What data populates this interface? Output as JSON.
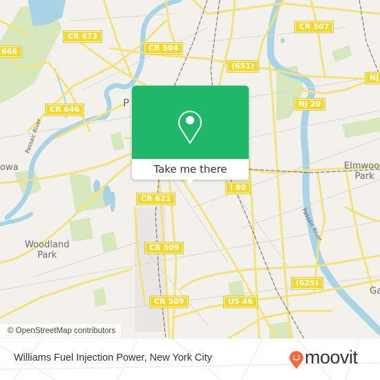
{
  "map": {
    "road_labels": [
      {
        "id": "cr666",
        "text": "666"
      },
      {
        "id": "cr673",
        "text": "CR 673"
      },
      {
        "id": "cr504",
        "text": "CR 504"
      },
      {
        "id": "cr507",
        "text": "CR 507"
      },
      {
        "id": "r651",
        "text": "(651)"
      },
      {
        "id": "cr646",
        "text": "CR 646"
      },
      {
        "id": "nj20a",
        "text": "NJ 20"
      },
      {
        "id": "nj20b",
        "text": "NJ"
      },
      {
        "id": "i80",
        "text": "I 80"
      },
      {
        "id": "cr621",
        "text": "CR 621"
      },
      {
        "id": "cr509a",
        "text": "CR 509"
      },
      {
        "id": "cr509b",
        "text": "CR 509"
      },
      {
        "id": "us46",
        "text": "US 46"
      },
      {
        "id": "r625",
        "text": "(625)"
      }
    ],
    "place_labels": [
      {
        "id": "paterson",
        "text": "P"
      },
      {
        "id": "elmwood",
        "text": "Elmwood\nPark"
      },
      {
        "id": "woodland",
        "text": "Woodland\nPark"
      },
      {
        "id": "totowa",
        "text": "owa"
      },
      {
        "id": "garfield",
        "text": "Ga"
      }
    ],
    "river_labels": {
      "left": "Passaic River",
      "right": "Passaic River"
    },
    "attribution": "© OpenStreetMap contributors"
  },
  "popup": {
    "icon": "map-pin-icon",
    "cta_label": "Take me there",
    "color": "#1fb86b"
  },
  "footer": {
    "place_title": "Williams Fuel Injection Power, New York City",
    "brand": "moovit",
    "brand_color": "#f26b3a"
  }
}
